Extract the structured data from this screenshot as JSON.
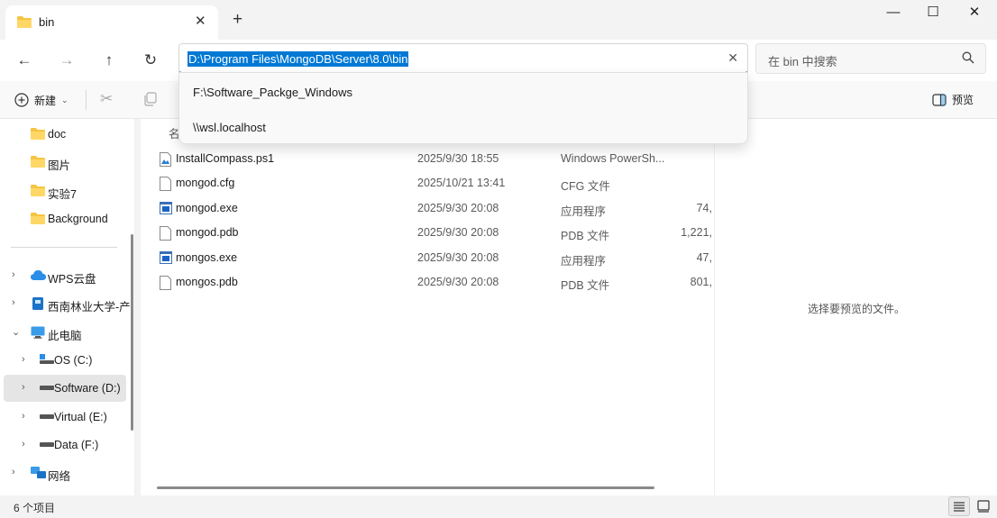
{
  "tab": {
    "title": "bin",
    "close": "✕"
  },
  "new_tab": "+",
  "window": {
    "min": "—",
    "max": "☐",
    "close": "✕"
  },
  "address": {
    "path": "D:\\Program Files\\MongoDB\\Server\\8.0\\bin",
    "clear": "✕"
  },
  "search": {
    "placeholder": "在 bin 中搜索"
  },
  "dropdown": {
    "items": [
      "F:\\Software_Packge_Windows",
      "\\\\wsl.localhost"
    ]
  },
  "toolbar": {
    "new_label": "新建",
    "preview_label": "预览"
  },
  "sidebar": {
    "items": [
      {
        "label": "doc",
        "icon": "folder-icon"
      },
      {
        "label": "图片",
        "icon": "folder-icon"
      },
      {
        "label": "实验7",
        "icon": "folder-icon"
      },
      {
        "label": "Background",
        "icon": "folder-icon"
      },
      {
        "label": "WPS云盘",
        "icon": "cloud-icon"
      },
      {
        "label": "西南林业大学-产",
        "icon": "org-folder-icon"
      },
      {
        "label": "此电脑",
        "icon": "computer-icon"
      },
      {
        "label": "OS (C:)",
        "icon": "os-drive-icon"
      },
      {
        "label": "Software (D:)",
        "icon": "drive-icon"
      },
      {
        "label": "Virtual (E:)",
        "icon": "drive-icon"
      },
      {
        "label": "Data (F:)",
        "icon": "drive-icon"
      },
      {
        "label": "网络",
        "icon": "network-icon"
      }
    ]
  },
  "list": {
    "header_name": "名",
    "files": [
      {
        "name": "InstallCompass.ps1",
        "date": "2025/9/30 18:55",
        "type": "Windows PowerSh...",
        "size": "",
        "icon": "script-file-icon"
      },
      {
        "name": "mongod.cfg",
        "date": "2025/10/21 13:41",
        "type": "CFG 文件",
        "size": "",
        "icon": "file-icon"
      },
      {
        "name": "mongod.exe",
        "date": "2025/9/30 20:08",
        "type": "应用程序",
        "size": "74,",
        "icon": "exe-icon"
      },
      {
        "name": "mongod.pdb",
        "date": "2025/9/30 20:08",
        "type": "PDB 文件",
        "size": "1,221,",
        "icon": "file-icon"
      },
      {
        "name": "mongos.exe",
        "date": "2025/9/30 20:08",
        "type": "应用程序",
        "size": "47,",
        "icon": "exe-icon"
      },
      {
        "name": "mongos.pdb",
        "date": "2025/9/30 20:08",
        "type": "PDB 文件",
        "size": "801,",
        "icon": "file-icon"
      }
    ]
  },
  "preview_pane": {
    "empty_text": "选择要预览的文件。"
  },
  "status": {
    "count": "6 个项目"
  },
  "colors": {
    "accent": "#0078d4",
    "folder": "#f4c542"
  }
}
